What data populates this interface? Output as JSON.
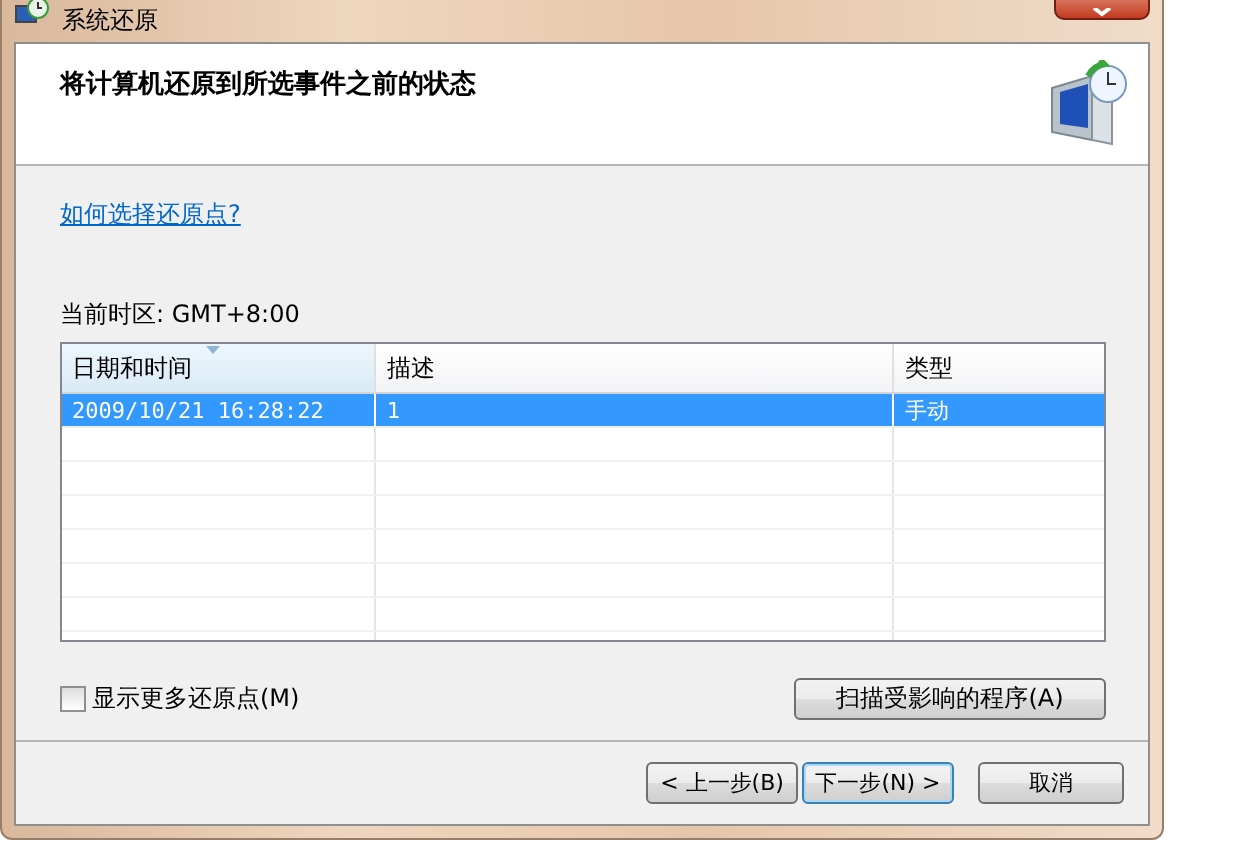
{
  "window": {
    "title": "系统还原"
  },
  "header": {
    "title": "将计算机还原到所选事件之前的状态"
  },
  "help_link": "如何选择还原点?",
  "timezone": "当前时区: GMT+8:00",
  "table": {
    "columns": [
      {
        "label": "日期和时间",
        "sorted": true
      },
      {
        "label": "描述",
        "sorted": false
      },
      {
        "label": "类型",
        "sorted": false
      }
    ],
    "rows": [
      {
        "cells": [
          "2009/10/21 16:28:22",
          "1",
          "手动"
        ],
        "selected": true
      }
    ]
  },
  "show_more": {
    "label": "显示更多还原点(M)",
    "checked": false
  },
  "scan_button": "扫描受影响的程序(A)",
  "buttons": [
    {
      "label": "< 上一步(B)",
      "default": false
    },
    {
      "label": "下一步(N) >",
      "default": true
    },
    {
      "label": "取消",
      "default": false
    }
  ]
}
